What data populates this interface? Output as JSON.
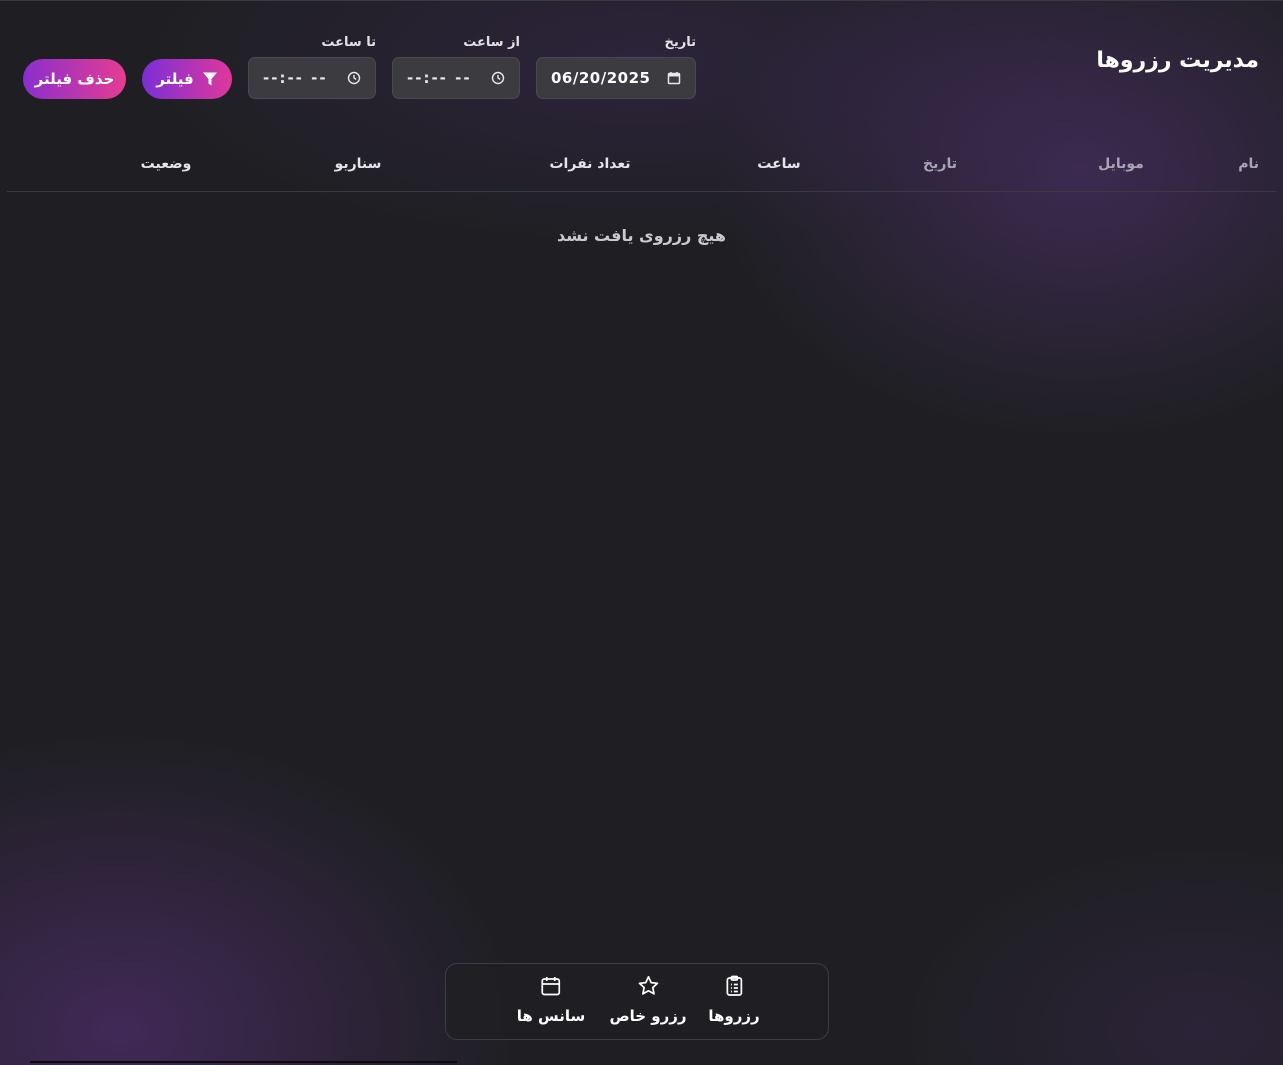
{
  "page": {
    "title": "مدیریت رزروها"
  },
  "filters": {
    "date": {
      "label": "تاریخ",
      "value": "06/20/2025",
      "icon": "calendar-icon"
    },
    "from_time": {
      "label": "از ساعت",
      "value": "--:-- --",
      "icon": "clock-icon"
    },
    "to_time": {
      "label": "تا ساعت",
      "value": "--:-- --",
      "icon": "clock-icon"
    },
    "filter_button": {
      "label": "فیلتر",
      "icon": "filter-icon"
    },
    "clear_button": {
      "label": "حذف فیلتر"
    }
  },
  "table": {
    "columns": [
      "نام",
      "موبایل",
      "تاریخ",
      "ساعت",
      "تعداد نفرات",
      "سناریو",
      "وضعیت"
    ],
    "empty_message": "هیچ رزروی یافت نشد"
  },
  "bottom_nav": {
    "items": [
      {
        "label": "رزروها",
        "icon": "clipboard-list-icon"
      },
      {
        "label": "رزرو خاص",
        "icon": "star-icon"
      },
      {
        "label": "سانس ها",
        "icon": "calendar-icon"
      }
    ]
  },
  "colors": {
    "background": "#1f1f23",
    "accent_gradient_start": "#7b2fd6",
    "accent_gradient_end": "#e0379b",
    "input_bg": "#3b3b40"
  }
}
